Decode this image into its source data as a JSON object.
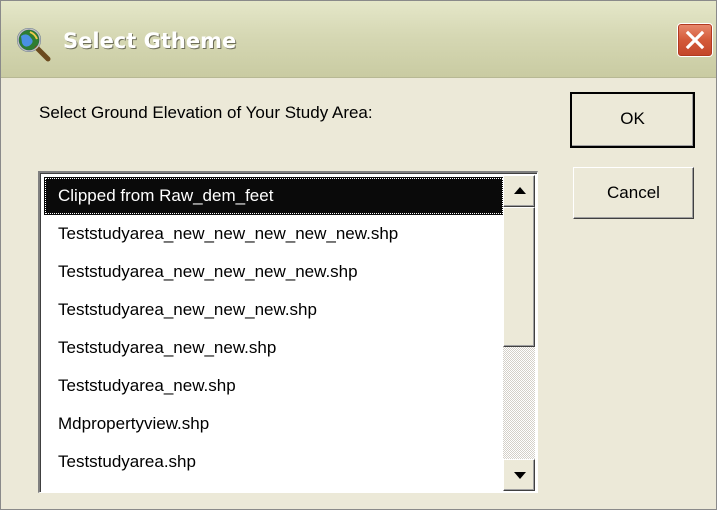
{
  "window": {
    "title": "Select Gtheme",
    "icon": "globe-magnifier-icon",
    "close_icon": "close-icon"
  },
  "prompt": "Select Ground Elevation of Your Study Area:",
  "buttons": {
    "ok": "OK",
    "cancel": "Cancel"
  },
  "listbox": {
    "selected_index": 0,
    "items": [
      "Clipped from Raw_dem_feet",
      "Teststudyarea_new_new_new_new_new.shp",
      "Teststudyarea_new_new_new_new.shp",
      "Teststudyarea_new_new_new.shp",
      "Teststudyarea_new_new.shp",
      "Teststudyarea_new.shp",
      "Mdpropertyview.shp",
      "Teststudyarea.shp"
    ]
  },
  "scrollbar": {
    "up_icon": "scroll-up-arrow-icon",
    "down_icon": "scroll-down-arrow-icon"
  },
  "colors": {
    "close_button": "#d45a3a",
    "selection_bg": "#0a0a0a",
    "dialog_bg": "#ece9d8"
  }
}
